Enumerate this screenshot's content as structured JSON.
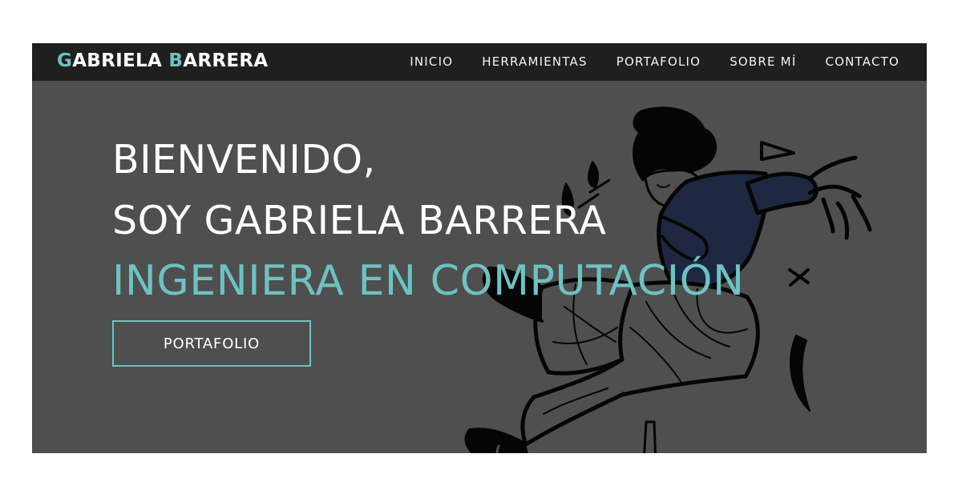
{
  "header": {
    "logo_parts": [
      "G",
      "ABRIELA ",
      "B",
      "ARRERA"
    ],
    "nav": [
      "INICIO",
      "HERRAMIENTAS",
      "PORTAFOLIO",
      "SOBRE MÍ",
      "CONTACTO"
    ]
  },
  "hero": {
    "line1": "BIENVENIDO,",
    "line2": "SOY GABRIELA BARRERA",
    "line3": "INGENIERA EN COMPUTACIÓN",
    "cta": "PORTAFOLIO"
  },
  "colors": {
    "accent": "#6cc3c2",
    "hero_background": "#4f4f4f",
    "navbar_background": "#1f1f1f"
  },
  "illustration": {
    "subject": "jumping-woman-illustration"
  }
}
